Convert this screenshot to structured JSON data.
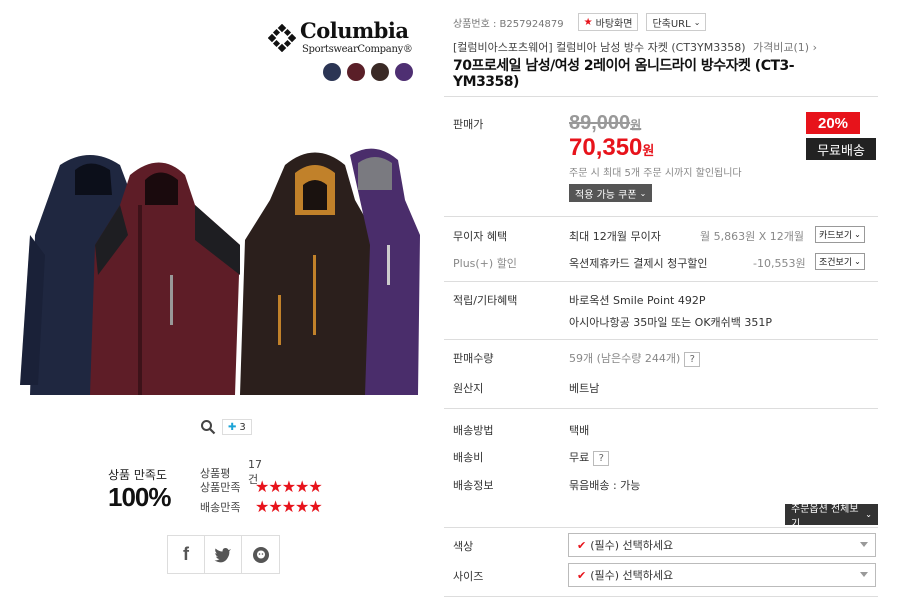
{
  "brand": {
    "name": "Columbia",
    "sub": "SportswearCompany®"
  },
  "swatches": [
    "#2b3554",
    "#5a1f28",
    "#3a2a26",
    "#4e2f72"
  ],
  "image_tools": {
    "more_count": "3"
  },
  "satisfaction": {
    "label": "상품 만족도",
    "value": "100%",
    "review_label": "상품평",
    "review_count": "17건",
    "product_label": "상품만족",
    "shipping_label": "배송만족",
    "stars": "★★★★★"
  },
  "topbar": {
    "product_no": "상품번호 : B257924879",
    "desktop_label": "바탕화면",
    "short_url_label": "단축URL"
  },
  "breadcrumb": {
    "text": "[컬럼비아스포츠웨어] 컬럼비아 남성 방수 자켓 (CT3YM3358)",
    "compare": "가격비교(1)"
  },
  "title": "70프로세일 남성/여성 2레이어 옴니드라이 방수자켓 (CT3-YM3358)",
  "price": {
    "label": "판매가",
    "original": "89,000",
    "sale": "70,350",
    "won": "원",
    "limit_note": "주문 시 최대 5개 주문 시까지 할인됩니다",
    "coupon_label": "적용 가능 쿠폰",
    "discount_badge": "20%",
    "shipping_badge": "무료배송"
  },
  "benefits": {
    "installment_label": "무이자 혜택",
    "installment_value": "최대 12개월 무이자",
    "installment_calc": "월 5,863원 X 12개월",
    "card_view": "카드보기",
    "plus_label": "Plus(+) 할인",
    "plus_value": "옥션제휴카드 결제시 청구할인",
    "plus_amount": "-10,553원",
    "condition_view": "조건보기"
  },
  "points": {
    "label": "적립/기타혜택",
    "line1": "바로옥션 Smile Point 492P",
    "line2": "아시아나항공 35마일 또는 OK캐쉬백 351P"
  },
  "sales": {
    "label": "판매수량",
    "value": "59개 (남은수량 244개)",
    "origin_label": "원산지",
    "origin_value": "베트남"
  },
  "shipping": {
    "method_label": "배송방법",
    "method_value": "택배",
    "fee_label": "배송비",
    "fee_value": "무료",
    "info_label": "배송정보",
    "info_value": "묶음배송 : 가능"
  },
  "options": {
    "all_button": "주문옵션 전체보기",
    "color_label": "색상",
    "size_label": "사이즈",
    "placeholder": "(필수) 선택하세요"
  }
}
